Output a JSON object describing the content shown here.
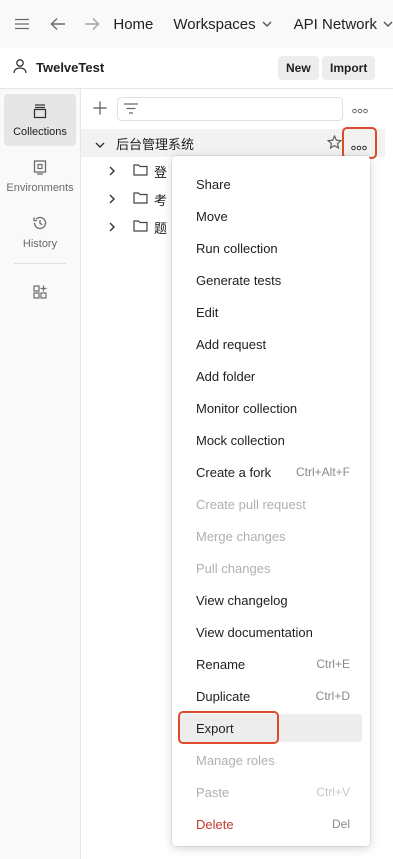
{
  "topbar": {
    "nav": [
      {
        "label": "Home"
      },
      {
        "label": "Workspaces"
      },
      {
        "label": "API Network"
      }
    ]
  },
  "workspace": {
    "name": "TwelveTest",
    "new_label": "New",
    "import_label": "Import"
  },
  "sidebar": {
    "items": [
      {
        "label": "Collections"
      },
      {
        "label": "Environments"
      },
      {
        "label": "History"
      }
    ]
  },
  "collection": {
    "name": "后台管理系统",
    "folders": [
      {
        "label": "登"
      },
      {
        "label": "考"
      },
      {
        "label": "题"
      }
    ]
  },
  "context_menu": {
    "items": [
      {
        "label": "Share",
        "shortcut": "",
        "state": "normal"
      },
      {
        "label": "Move",
        "shortcut": "",
        "state": "normal"
      },
      {
        "label": "Run collection",
        "shortcut": "",
        "state": "normal"
      },
      {
        "label": "Generate tests",
        "shortcut": "",
        "state": "normal"
      },
      {
        "label": "Edit",
        "shortcut": "",
        "state": "normal"
      },
      {
        "label": "Add request",
        "shortcut": "",
        "state": "normal"
      },
      {
        "label": "Add folder",
        "shortcut": "",
        "state": "normal"
      },
      {
        "label": "Monitor collection",
        "shortcut": "",
        "state": "normal"
      },
      {
        "label": "Mock collection",
        "shortcut": "",
        "state": "normal"
      },
      {
        "label": "Create a fork",
        "shortcut": "Ctrl+Alt+F",
        "state": "normal"
      },
      {
        "label": "Create pull request",
        "shortcut": "",
        "state": "disabled"
      },
      {
        "label": "Merge changes",
        "shortcut": "",
        "state": "disabled"
      },
      {
        "label": "Pull changes",
        "shortcut": "",
        "state": "disabled"
      },
      {
        "label": "View changelog",
        "shortcut": "",
        "state": "normal"
      },
      {
        "label": "View documentation",
        "shortcut": "",
        "state": "normal"
      },
      {
        "label": "Rename",
        "shortcut": "Ctrl+E",
        "state": "normal"
      },
      {
        "label": "Duplicate",
        "shortcut": "Ctrl+D",
        "state": "normal"
      },
      {
        "label": "Export",
        "shortcut": "",
        "state": "hover"
      },
      {
        "label": "Manage roles",
        "shortcut": "",
        "state": "disabled"
      },
      {
        "label": "Paste",
        "shortcut": "Ctrl+V",
        "state": "disabled"
      },
      {
        "label": "Delete",
        "shortcut": "Del",
        "state": "danger"
      }
    ]
  },
  "colors": {
    "highlight": "#e0492b",
    "danger": "#c0392b",
    "disabled": "#b0b0b0"
  }
}
